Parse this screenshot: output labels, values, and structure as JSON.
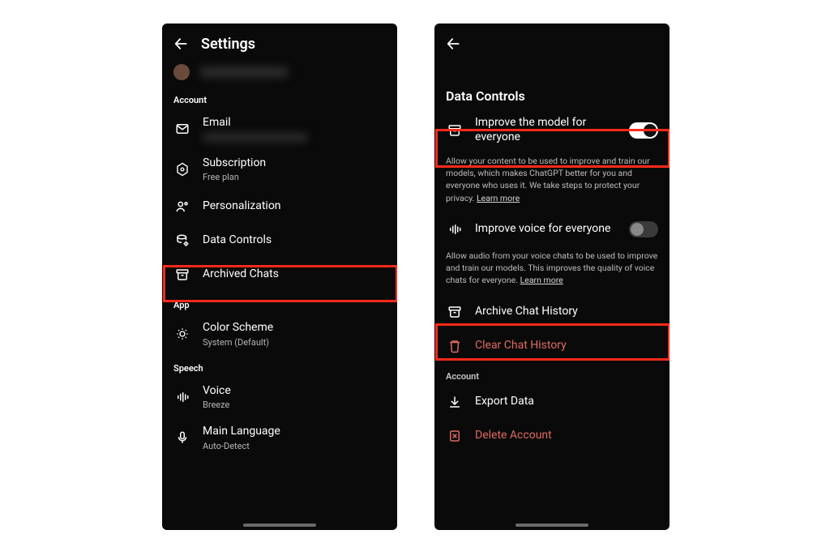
{
  "left": {
    "title": "Settings",
    "sections": {
      "account": "Account",
      "app": "App",
      "speech": "Speech"
    },
    "email": {
      "label": "Email"
    },
    "subscription": {
      "label": "Subscription",
      "sub": "Free plan"
    },
    "personalization": {
      "label": "Personalization"
    },
    "dataControls": {
      "label": "Data Controls"
    },
    "archived": {
      "label": "Archived Chats"
    },
    "colorScheme": {
      "label": "Color Scheme",
      "sub": "System (Default)"
    },
    "voice": {
      "label": "Voice",
      "sub": "Breeze"
    },
    "mainLang": {
      "label": "Main Language",
      "sub": "Auto-Detect"
    }
  },
  "right": {
    "title": "Data Controls",
    "improveModel": {
      "label": "Improve the model for everyone",
      "on": true
    },
    "improveModelDesc": "Allow your content to be used to improve and train our models, which makes ChatGPT better for you and everyone who uses it. We take steps to protect your privacy.",
    "improveVoice": {
      "label": "Improve voice for everyone",
      "on": false
    },
    "improveVoiceDesc": "Allow audio from your voice chats to be used to improve and train our models. This improves the quality of voice chats for everyone.",
    "learnMore": "Learn more",
    "archiveHistory": {
      "label": "Archive Chat History"
    },
    "clearHistory": {
      "label": "Clear Chat History"
    },
    "accountSection": "Account",
    "exportData": {
      "label": "Export Data"
    },
    "deleteAccount": {
      "label": "Delete Account"
    }
  }
}
